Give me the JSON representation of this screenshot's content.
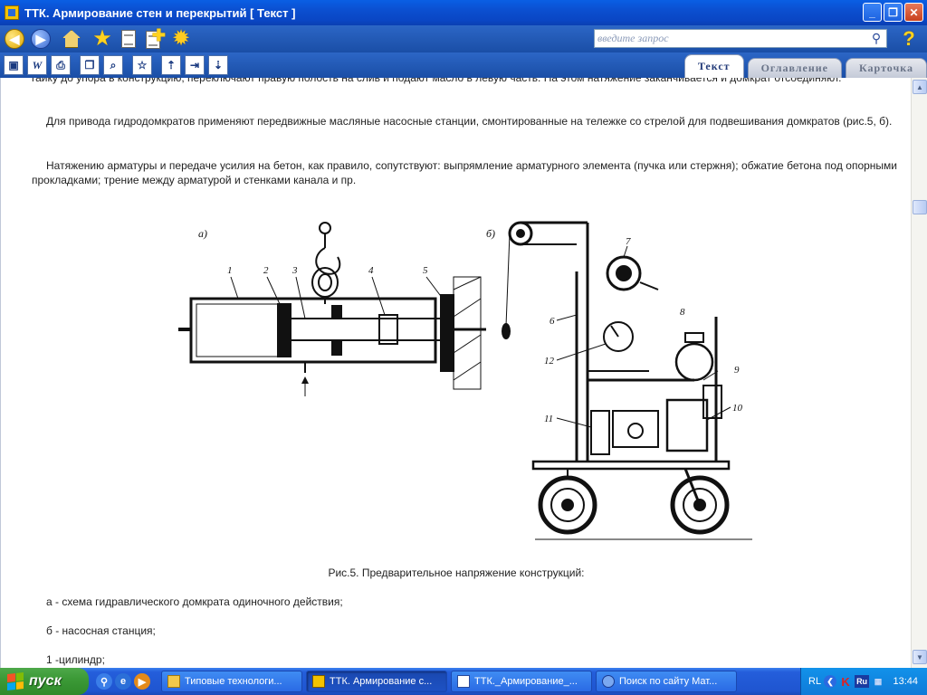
{
  "window": {
    "title": "ТТК. Армирование стен и перекрытий [ Текст ]",
    "minimize": "_",
    "maximize": "❐",
    "close": "✕"
  },
  "toolbar": {
    "search_placeholder": "введите запрос",
    "help": "?"
  },
  "tabs": [
    {
      "label": "Текст",
      "active": true
    },
    {
      "label": "Оглавление",
      "active": false
    },
    {
      "label": "Карточка",
      "active": false
    }
  ],
  "content": {
    "top_partial": "гайку до упора в конструкцию, переключают правую полость на слив и подают масло в левую часть. На этом натяжение заканчивается и домкрат отсоединяют.",
    "para2": "Для привода гидродомкратов применяют передвижные масляные насосные станции, смонтированные на тележке со стрелой для подвешивания домкратов (рис.5, б).",
    "para3": "Натяжению арматуры и передаче усилия на бетон, как правило, сопутствуют: выпрямление арматурного элемента (пучка или стержня); обжатие бетона под опорными прокладками; трение между арматурой и стенками канала и пр.",
    "figure": {
      "label_a": "а)",
      "label_b": "б)",
      "nums_a": [
        "1",
        "2",
        "3",
        "4",
        "5"
      ],
      "nums_b": [
        "6",
        "7",
        "8",
        "9",
        "10",
        "11",
        "12"
      ]
    },
    "caption": "Рис.5. Предварительное напряжение конструкций:",
    "items": [
      "а - схема гидравлического домкрата одиночного действия;",
      "б - насосная станция;",
      "1 -цилиндр;"
    ]
  },
  "taskbar": {
    "start": "пуск",
    "tasks": [
      {
        "label": "Типовые технологи...",
        "active": false
      },
      {
        "label": "ТТК. Армирование с...",
        "active": true
      },
      {
        "label": "ТТК._Армирование_...",
        "active": false
      },
      {
        "label": "Поиск по сайту Мат...",
        "active": false
      }
    ],
    "lang": "RL",
    "tray_ru": "Ru",
    "clock": "13:44"
  }
}
